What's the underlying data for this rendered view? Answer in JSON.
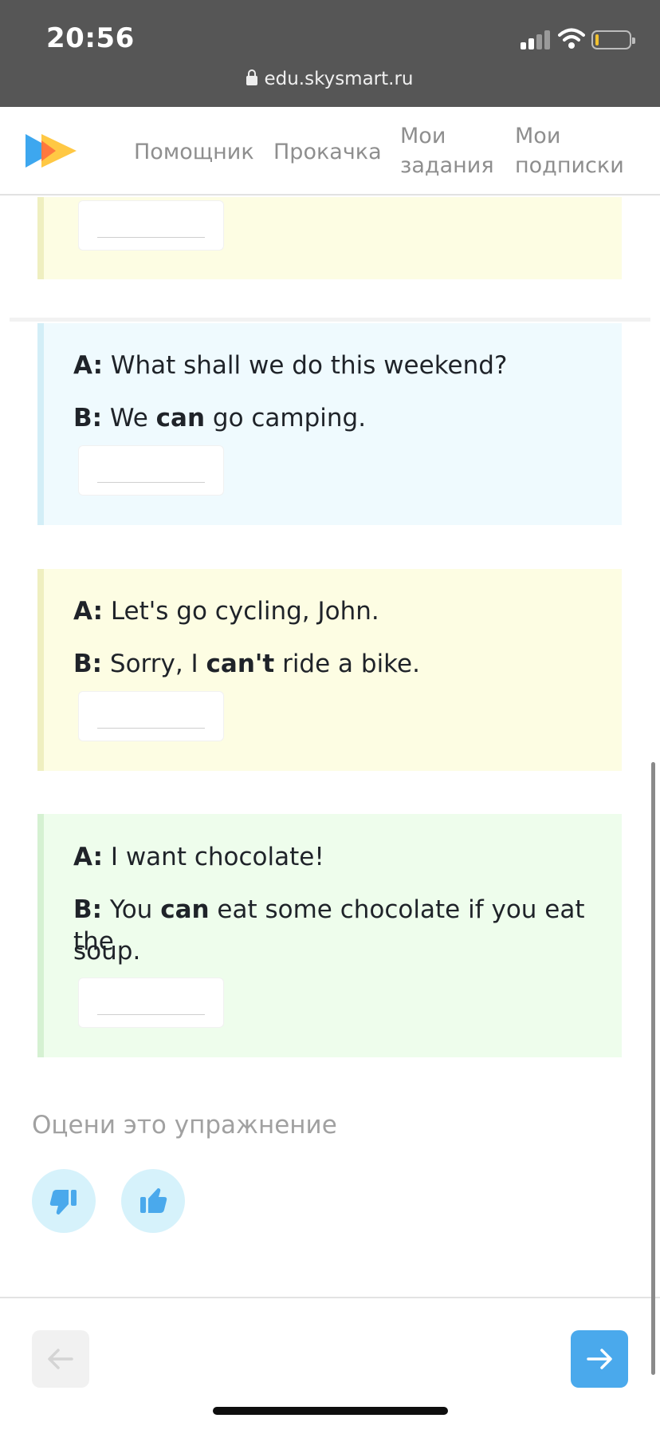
{
  "status_bar": {
    "time": "20:56",
    "url": "edu.skysmart.ru"
  },
  "header": {
    "nav": [
      {
        "label": "Помощник"
      },
      {
        "label": "Прокачка"
      },
      {
        "label": "Мои задания"
      },
      {
        "label": "Мои подписки"
      }
    ]
  },
  "dialogs": [
    {
      "a_speaker": "A:",
      "a_text": "What shall we do this weekend?",
      "b_speaker": "B:",
      "b_before": "We ",
      "b_bold": "can",
      "b_after": " go camping."
    },
    {
      "a_speaker": "A:",
      "a_text": "Let's go cycling, John.",
      "b_speaker": "B:",
      "b_before": "Sorry, I ",
      "b_bold": "can't",
      "b_after": " ride a bike."
    },
    {
      "a_speaker": "A:",
      "a_text": "I want chocolate!",
      "b_speaker": "B:",
      "b_before": "You ",
      "b_bold": "can",
      "b_after": " eat some chocolate if you eat the",
      "b_continued": "soup."
    }
  ],
  "rating": {
    "title": "Оцени это упражнение"
  },
  "colors": {
    "card_yellow": "#fdfde3",
    "card_blue": "#effafe",
    "card_green": "#eefdec",
    "accent": "#4aa9ec"
  },
  "icons": [
    "lock-icon",
    "signal-icon",
    "wifi-icon",
    "battery-icon",
    "skysmart-logo",
    "thumbs-down-icon",
    "thumbs-up-icon",
    "arrow-left-icon",
    "arrow-right-icon"
  ]
}
